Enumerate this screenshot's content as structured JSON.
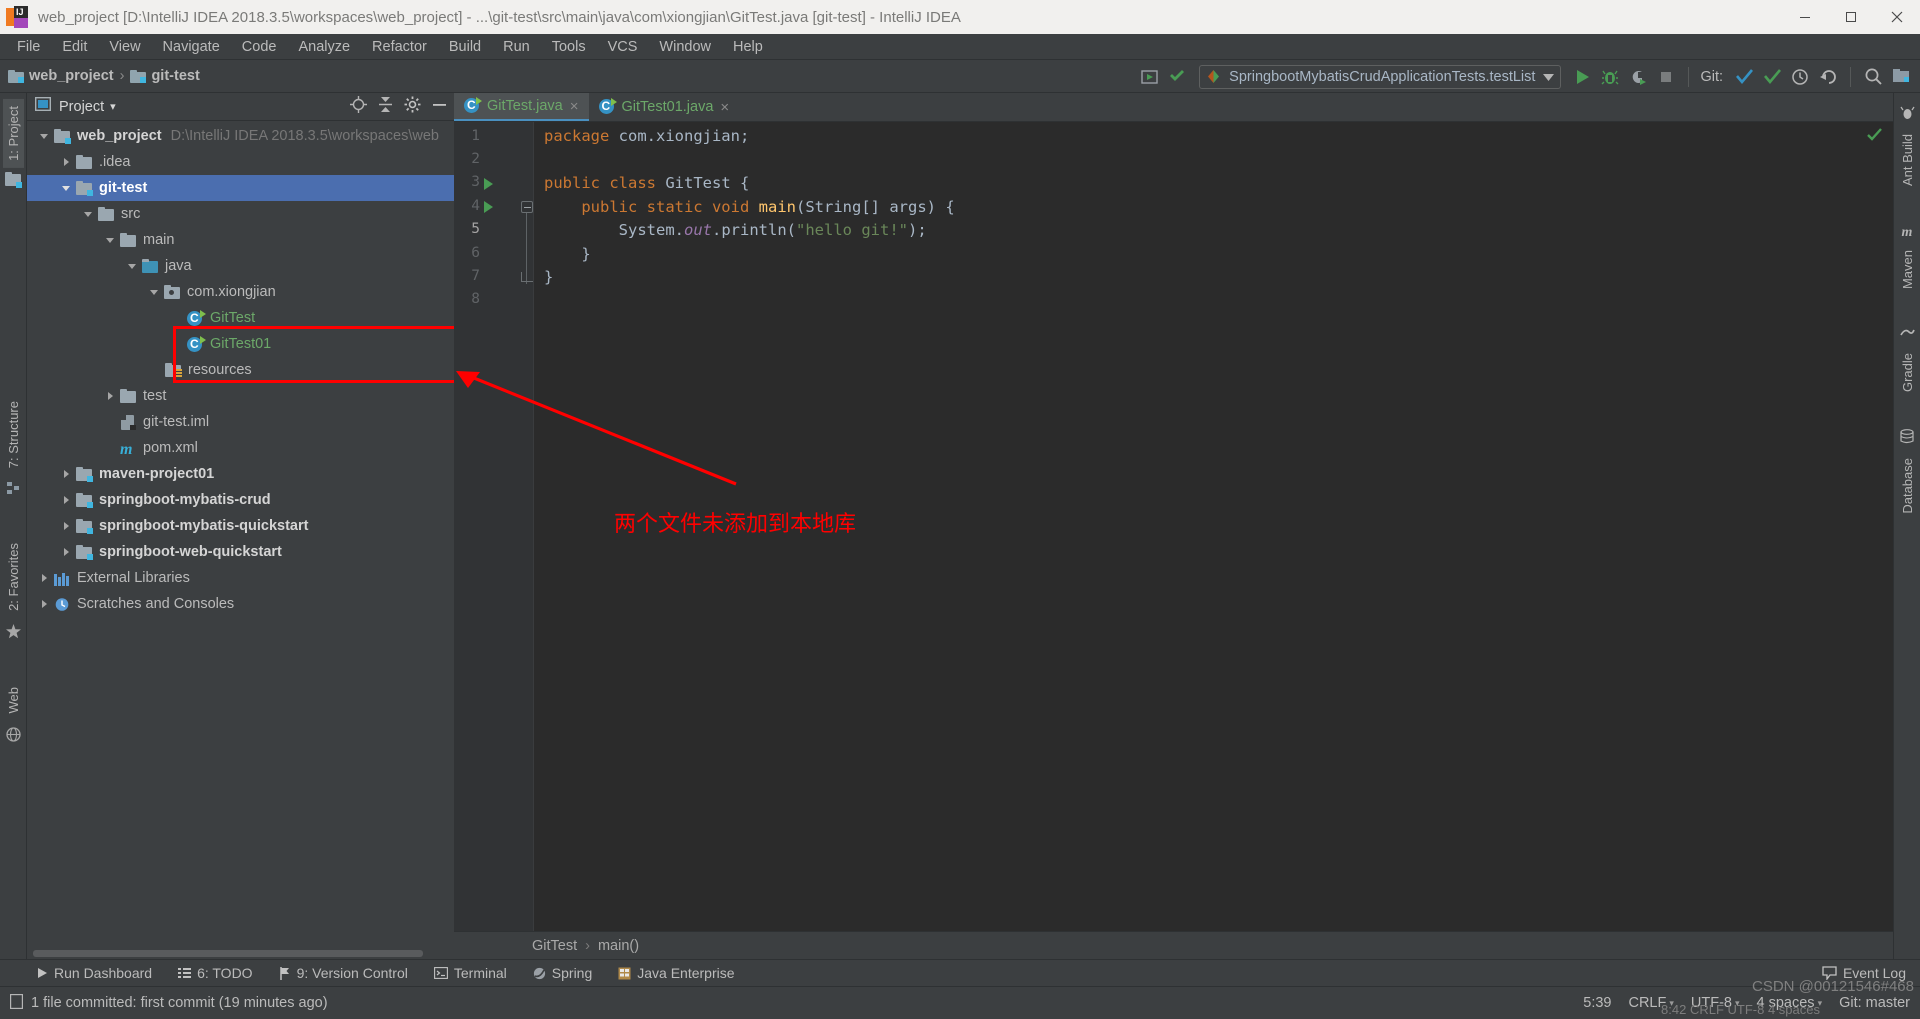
{
  "window": {
    "title": "web_project [D:\\IntelliJ IDEA 2018.3.5\\workspaces\\web_project] - ...\\git-test\\src\\main\\java\\com\\xiongjian\\GitTest.java [git-test] - IntelliJ IDEA",
    "minimize_label": "minimize-icon",
    "maximize_label": "maximize-icon",
    "close_label": "close-icon"
  },
  "menubar": [
    {
      "label": "File"
    },
    {
      "label": "Edit"
    },
    {
      "label": "View"
    },
    {
      "label": "Navigate"
    },
    {
      "label": "Code"
    },
    {
      "label": "Analyze"
    },
    {
      "label": "Refactor"
    },
    {
      "label": "Build"
    },
    {
      "label": "Run"
    },
    {
      "label": "Tools"
    },
    {
      "label": "VCS"
    },
    {
      "label": "Window"
    },
    {
      "label": "Help"
    }
  ],
  "navbar": {
    "crumb1": "web_project",
    "crumb_sep": "›",
    "crumb2": "git-test",
    "run_config": "SpringbootMybatisCrudApplicationTests.testList",
    "git_label": "Git:"
  },
  "project_panel": {
    "title": "Project",
    "caret": "▾",
    "tree": [
      {
        "indent": 0,
        "arrow": "down",
        "icon": "module-folder",
        "label": "web_project",
        "bold": true,
        "path": "D:\\IntelliJ IDEA 2018.3.5\\workspaces\\web",
        "selected": false
      },
      {
        "indent": 1,
        "arrow": "right",
        "icon": "folder",
        "label": ".idea",
        "bold": false,
        "selected": false
      },
      {
        "indent": 1,
        "arrow": "down",
        "icon": "module-folder",
        "label": "git-test",
        "bold": true,
        "selected": true
      },
      {
        "indent": 2,
        "arrow": "down",
        "icon": "folder",
        "label": "src",
        "bold": false,
        "selected": false
      },
      {
        "indent": 3,
        "arrow": "down",
        "icon": "folder",
        "label": "main",
        "bold": false,
        "selected": false
      },
      {
        "indent": 4,
        "arrow": "down",
        "icon": "source-folder",
        "label": "java",
        "bold": false,
        "selected": false
      },
      {
        "indent": 5,
        "arrow": "down",
        "icon": "package",
        "label": "com.xiongjian",
        "bold": false,
        "selected": false
      },
      {
        "indent": 6,
        "arrow": "none",
        "icon": "java-class",
        "label": "GitTest",
        "bold": false,
        "green": true,
        "selected": false
      },
      {
        "indent": 6,
        "arrow": "none",
        "icon": "java-class",
        "label": "GitTest01",
        "bold": false,
        "green": true,
        "selected": false
      },
      {
        "indent": 5,
        "arrow": "none",
        "icon": "resources-folder",
        "label": "resources",
        "bold": false,
        "selected": false
      },
      {
        "indent": 3,
        "arrow": "right",
        "icon": "folder",
        "label": "test",
        "bold": false,
        "selected": false
      },
      {
        "indent": 3,
        "arrow": "none",
        "icon": "iml-file",
        "label": "git-test.iml",
        "bold": false,
        "selected": false
      },
      {
        "indent": 3,
        "arrow": "none",
        "icon": "maven-file",
        "label": "pom.xml",
        "bold": false,
        "selected": false
      },
      {
        "indent": 1,
        "arrow": "right",
        "icon": "module-folder",
        "label": "maven-project01",
        "bold": true,
        "selected": false
      },
      {
        "indent": 1,
        "arrow": "right",
        "icon": "module-folder",
        "label": "springboot-mybatis-crud",
        "bold": true,
        "selected": false
      },
      {
        "indent": 1,
        "arrow": "right",
        "icon": "module-folder",
        "label": "springboot-mybatis-quickstart",
        "bold": true,
        "selected": false
      },
      {
        "indent": 1,
        "arrow": "right",
        "icon": "module-folder",
        "label": "springboot-web-quickstart",
        "bold": true,
        "selected": false
      },
      {
        "indent": 0,
        "arrow": "right",
        "icon": "libraries",
        "label": "External Libraries",
        "bold": false,
        "selected": false
      },
      {
        "indent": 0,
        "arrow": "none",
        "icon": "scratches",
        "label": "Scratches and Consoles",
        "bold": false,
        "selected": false
      }
    ]
  },
  "left_strip": [
    {
      "label": "1: Project",
      "active": true
    },
    {
      "label": "7: Structure",
      "active": false
    },
    {
      "label": "2: Favorites",
      "active": false
    },
    {
      "label": "Web",
      "active": false
    }
  ],
  "right_strip": [
    {
      "label": "Ant Build"
    },
    {
      "label": "Maven"
    },
    {
      "label": "Gradle"
    },
    {
      "label": "Database"
    }
  ],
  "editor": {
    "tabs": [
      {
        "label": "GitTest.java",
        "active": true,
        "close": "×"
      },
      {
        "label": "GitTest01.java",
        "active": false,
        "close": "×"
      }
    ],
    "line_numbers": [
      "1",
      "2",
      "3",
      "4",
      "5",
      "6",
      "7",
      "8"
    ],
    "code_lines": [
      "package com.xiongjian;",
      "",
      "public class GitTest {",
      "    public static void main(String[] args) {",
      "        System.out.println(\"hello git!\");",
      "    }",
      "}",
      ""
    ],
    "breadcrumb": [
      "GitTest",
      "main()"
    ],
    "breadcrumb_sep": "›"
  },
  "annotation": {
    "text": "两个文件未添加到本地库",
    "color": "#ff0000"
  },
  "tool_windows": [
    {
      "label": "Run Dashboard",
      "icon": "play-icon"
    },
    {
      "label": "6: TODO",
      "icon": "todo-icon"
    },
    {
      "label": "9: Version Control",
      "icon": "vcs-icon"
    },
    {
      "label": "Terminal",
      "icon": "terminal-icon"
    },
    {
      "label": "Spring",
      "icon": "spring-icon"
    },
    {
      "label": "Java Enterprise",
      "icon": "java-ee-icon"
    }
  ],
  "event_log": {
    "label": "Event Log",
    "icon": "balloon-icon"
  },
  "statusbar": {
    "message": "1 file committed: first commit (19 minutes ago)",
    "caret_position": "5:39",
    "line_separator": "CRLF",
    "encoding": "UTF-8",
    "indent": "4 spaces",
    "branch": "Git: master",
    "caret_glyph": "≡"
  },
  "watermarks": {
    "primary": "CSDN @00121546#468",
    "secondary": "8:42  CRLF  UTF-8  4 spaces"
  },
  "colors": {
    "accent_blue": "#4b6eaf",
    "new_file_green": "#6ca869",
    "annotation_red": "#ff0000",
    "panel_bg": "#3c3f41",
    "editor_bg": "#2b2b2b"
  }
}
